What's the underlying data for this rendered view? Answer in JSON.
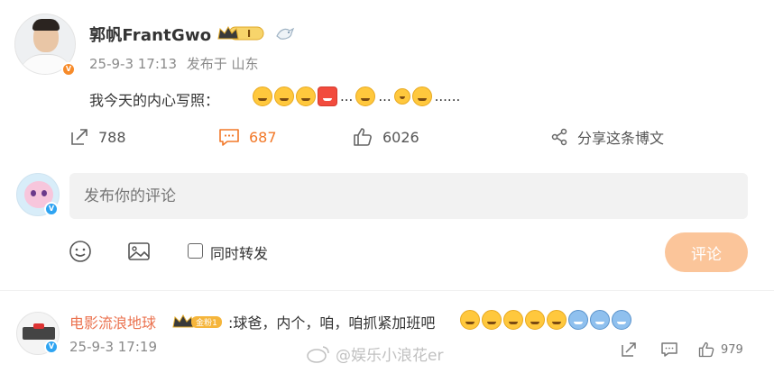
{
  "post": {
    "author": {
      "name": "郭帆FrantGwo",
      "level_badge": "I",
      "avatar_icon": "user-avatar-photo",
      "verified_color": "#f78b2a"
    },
    "time": "25-9-3 17:13",
    "location": "发布于 山东",
    "text": "我今天的内心写照：",
    "emoji_dots": [
      "...",
      "...",
      "......"
    ],
    "stats": {
      "repost_count": "788",
      "comment_count": "687",
      "like_count": "6026",
      "share_label": "分享这条博文"
    }
  },
  "compose": {
    "placeholder": "发布你的评论",
    "repost_label": "同时转发",
    "submit_label": "评论",
    "accent_color": "#f27828"
  },
  "comments": [
    {
      "user": "电影流浪地球",
      "fan_badge": "金粉1",
      "text": ":球爸，内个，咱，咱抓紧加班吧",
      "time": "25-9-3 17:19",
      "like_count": "979"
    }
  ],
  "watermark": {
    "text": "@娱乐小浪花er"
  }
}
